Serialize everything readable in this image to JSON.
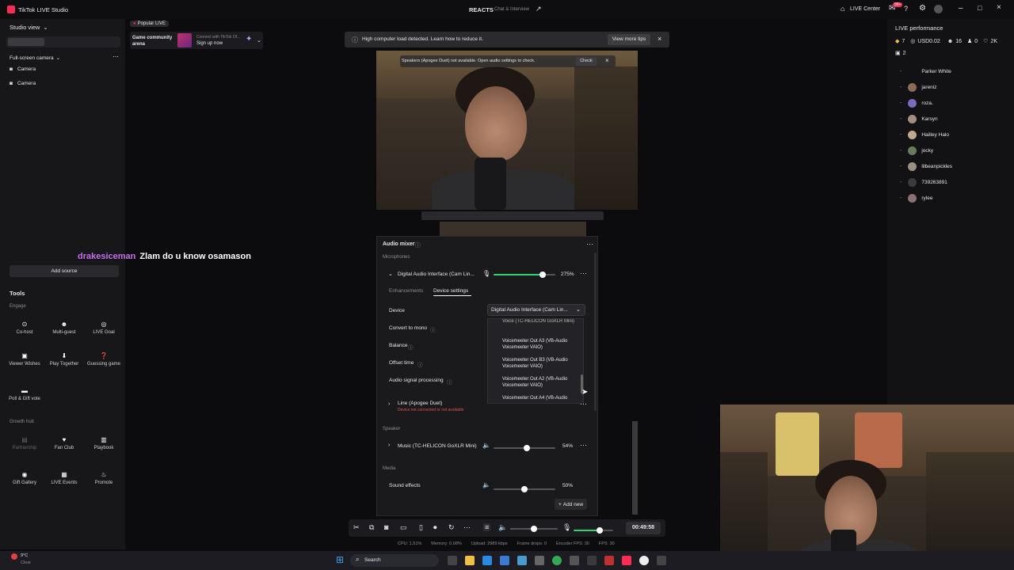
{
  "titlebar": {
    "app_name": "TikTok LIVE Studio",
    "center_title": "REACTS",
    "center_subtitle": "Chat & Interview",
    "live_center": "LIVE Center",
    "notif_badge": "99+"
  },
  "sidebar": {
    "studio_view": "Studio view",
    "scene_name": "Full-screen camera",
    "sources": [
      "Camera",
      "Camera"
    ],
    "add_source": "Add source",
    "tools_title": "Tools",
    "engage_label": "Engage",
    "engage_tools": [
      {
        "label": "Co-host",
        "icon": "cohost-icon"
      },
      {
        "label": "Multi-guest",
        "icon": "multiguest-icon"
      },
      {
        "label": "LIVE Goal",
        "icon": "goal-icon"
      },
      {
        "label": "Viewer Wishes",
        "icon": "gift-icon"
      },
      {
        "label": "Play Together",
        "icon": "play-icon"
      },
      {
        "label": "Guessing game",
        "icon": "question-icon"
      },
      {
        "label": "Poll & Gift vote",
        "icon": "poll-icon"
      }
    ],
    "growth_label": "Growth hub",
    "growth_tools": [
      {
        "label": "Partnership",
        "icon": "partnership-icon"
      },
      {
        "label": "Fan Club",
        "icon": "heart-icon"
      },
      {
        "label": "Playbook",
        "icon": "book-icon"
      },
      {
        "label": "Gift Gallery",
        "icon": "gallery-icon"
      },
      {
        "label": "LIVE Events",
        "icon": "calendar-icon"
      },
      {
        "label": "Promote",
        "icon": "flame-icon"
      }
    ]
  },
  "popular": {
    "tag": "Popular LIVE",
    "card_title": "Game community arena",
    "promo_line1": "Connect with TikTok Of...",
    "promo_line2": "Sign up now"
  },
  "alerts": {
    "load_text": "High computer load detected. Learn how to reduce it.",
    "load_button": "View more tips",
    "speaker_text": "Speakers (Apogee Duet) not available. Open audio settings to check.",
    "speaker_button": "Check"
  },
  "chat": {
    "username": "drakesiceman",
    "message": "Zlam do u know osamason"
  },
  "mixer": {
    "title": "Audio mixer",
    "microphones_label": "Microphones",
    "mic1_name": "Digital Audio Interface (Cam Lin...",
    "mic1_level": 0.79,
    "mic1_percent": "275%",
    "tab_enhancements": "Enhancements",
    "tab_device": "Device settings",
    "device_label": "Device",
    "device_value": "Digital Audio Interface (Cam Lin...",
    "convert_mono": "Convert to mono",
    "balance": "Balance",
    "offset_time": "Offset time",
    "signal_processing": "Audio signal processing",
    "dropdown_options": [
      "Voice (TC-HELICON GoXLR Mini)",
      "Voicemeeter Out A3 (VB-Audio Voicemeeter VAIO)",
      "Voicemeeter Out B3 (VB-Audio Voicemeeter VAIO)",
      "Voicemeeter Out A2 (VB-Audio Voicemeeter VAIO)",
      "Voicemeeter Out A4 (VB-Audio"
    ],
    "mic2_name": "Line (Apogee Duet)",
    "mic2_error": "Device not connected or not available",
    "speaker_label": "Speaker",
    "speaker_name": "Music (TC-HELICON GoXLR Mini)",
    "speaker_level": 0.54,
    "speaker_percent": "54%",
    "media_label": "Media",
    "media_name": "Sound effects",
    "media_level": 0.5,
    "media_percent": "50%",
    "add_new": "Add new"
  },
  "controls": {
    "volume_level": 0.5,
    "mic_level": 0.65,
    "timer": "00:49:58"
  },
  "stats": {
    "cpu": "CPU: 1.51%",
    "memory": "Memory: 0.08%",
    "upload": "Upload: 2989 kbps",
    "frame_drops": "Frame drops: 0",
    "encoder_fps": "Encoder FPS: 30",
    "fps": "FPS: 30"
  },
  "performance": {
    "title": "LIVE performance",
    "diamonds": "7",
    "usd": "USD0.02",
    "viewers": "16",
    "gifters": "0",
    "likes": "2K",
    "subs": "2"
  },
  "viewers": [
    "Parker White",
    "jareniz",
    "roza.",
    "Karsyn",
    "Hailley Halo",
    "jocky",
    "lilbeanpickles",
    "739263891",
    "rylee"
  ],
  "weather": {
    "temp": "9°C",
    "condition": "Clear"
  },
  "taskbar": {
    "search": "Search"
  }
}
